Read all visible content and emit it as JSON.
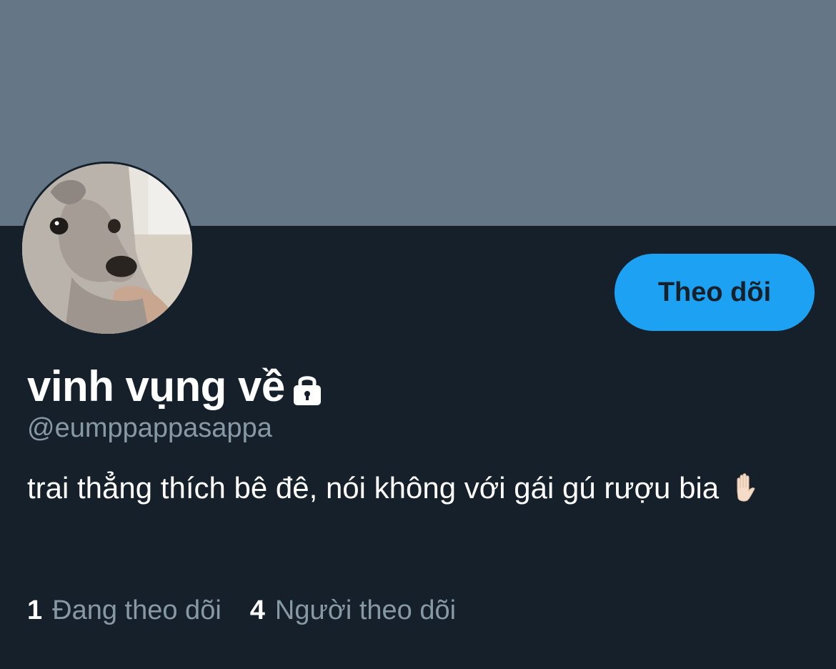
{
  "profile": {
    "display_name": "vinh vụng về",
    "handle": "@eumppappasappa",
    "bio": "trai thẳng thích bê đê, nói không với gái gú rượu bia",
    "verified_icon": "lock-icon",
    "avatar_icon": "dog-avatar"
  },
  "actions": {
    "follow_label": "Theo dõi"
  },
  "stats": {
    "following_count": "1",
    "following_label": "Đang theo dõi",
    "followers_count": "4",
    "followers_label": "Người theo dõi"
  },
  "colors": {
    "background": "#15202b",
    "banner": "#657786",
    "accent": "#1da1f2",
    "secondary_text": "#8899a6",
    "primary_text": "#ffffff"
  }
}
